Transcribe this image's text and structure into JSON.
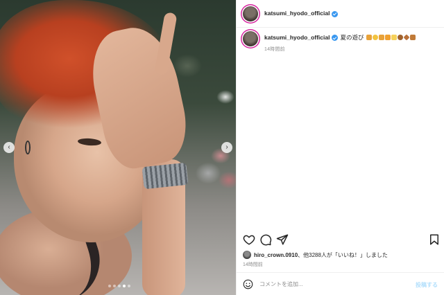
{
  "post": {
    "username": "katsumi_hyodo_official",
    "verified": true,
    "caption": "夏の遊び",
    "caption_emojis": [
      "hand-icon",
      "smile-icon",
      "hand-icon",
      "heart-icon",
      "sparkle-icon",
      "brown-circle-icon",
      "brown-diamond-icon",
      "brown-square-icon"
    ],
    "caption_time": "14時間前",
    "likes": {
      "user": "hiro_crown.0910",
      "rest": "、他3288人が「いいね！」しました"
    },
    "post_time": "14時間前"
  },
  "carousel": {
    "total": 5,
    "active_index": 3,
    "prev_label": "‹",
    "next_label": "›"
  },
  "comment": {
    "placeholder": "コメントを追加...",
    "post_label": "投稿する"
  },
  "colors": {
    "verified": "#3897f0",
    "post_button": "#b2dffc",
    "muted": "#8e8e8e"
  }
}
